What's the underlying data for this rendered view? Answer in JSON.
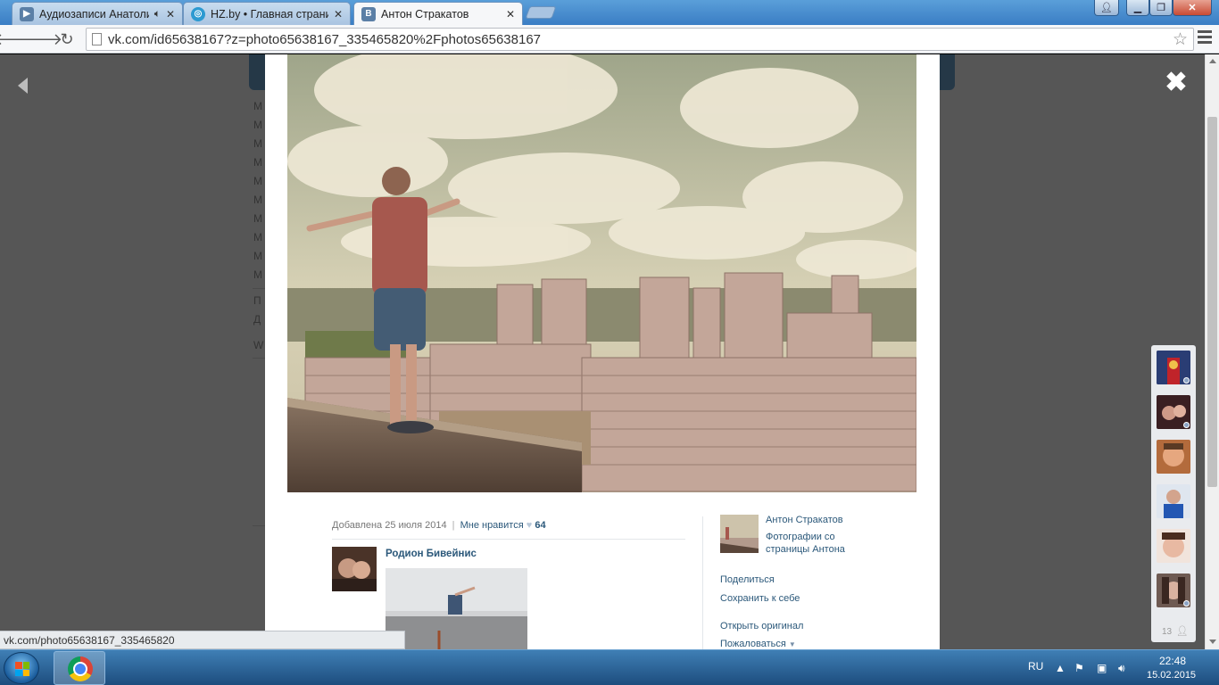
{
  "browser": {
    "tabs": [
      {
        "title": "Аудиозаписи Анатолия",
        "favicon": "vk",
        "audio": true
      },
      {
        "title": "HZ.by • Главная страница",
        "favicon": "hz"
      },
      {
        "title": "Антон Стракатов",
        "favicon": "vk",
        "active": true
      }
    ],
    "address": "vk.com/id65638167?z=photo65638167_335465820%2Fphotos65638167",
    "status_url": "vk.com/photo65638167_335465820",
    "window_buttons": [
      "minimize",
      "restore",
      "close"
    ]
  },
  "viewer": {
    "added_text": "Добавлена 25 июля 2014",
    "separator": "|",
    "like_label": "Мне нравится",
    "likes": "64",
    "comment": {
      "author": "Родион Бивейнис"
    },
    "sidebar": {
      "author": "Антон Стракатов",
      "album": "Фотографии со страницы Антона",
      "share": "Поделиться",
      "save": "Сохранить к себе",
      "original": "Открыть оригинал",
      "report": "Пожаловаться"
    },
    "close_symbol": "✖",
    "background_menu": [
      "М",
      "М",
      "М",
      "М",
      "М",
      "М",
      "М",
      "М",
      "М",
      "М",
      "П",
      "Д",
      "W"
    ]
  },
  "friends_online": {
    "count": "13",
    "avatars": [
      "friend-1",
      "friend-2",
      "friend-3",
      "friend-4",
      "friend-5",
      "friend-6"
    ]
  },
  "taskbar": {
    "language": "RU",
    "time": "22:48",
    "date": "15.02.2015"
  },
  "colors": {
    "vk_link": "#2b587a",
    "overlay": "#565656",
    "vk_header": "#253847"
  }
}
